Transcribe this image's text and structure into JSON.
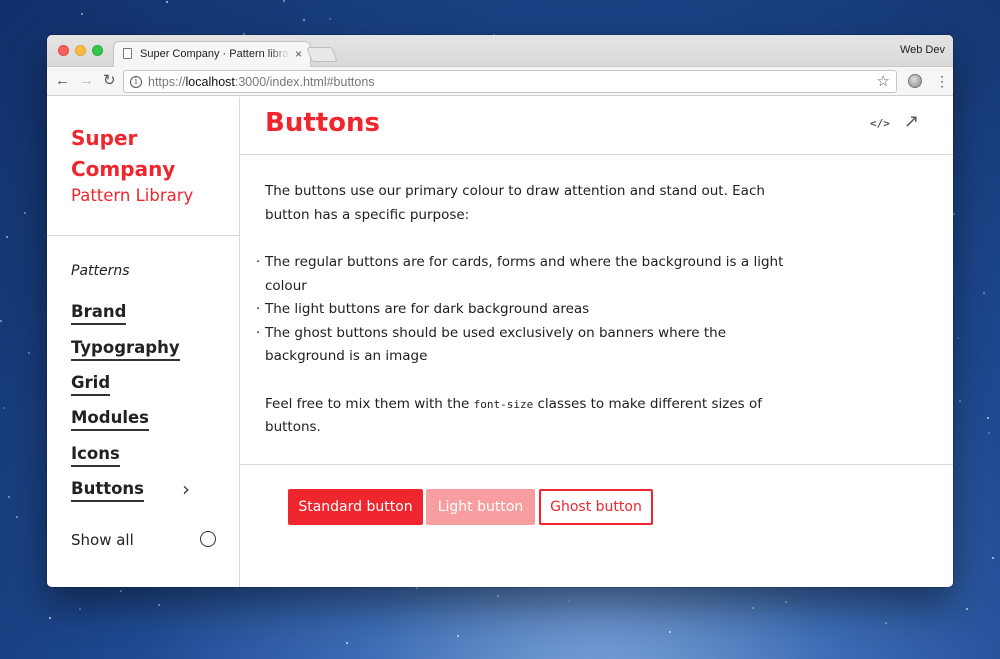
{
  "browser": {
    "tab_title": "Super Company · Pattern library",
    "tab_close": "×",
    "profile_name": "Web Dev",
    "url_scheme": "https://",
    "url_host": "localhost",
    "url_rest": ":3000/index.html#buttons",
    "back_glyph": "←",
    "forward_glyph": "→",
    "reload_glyph": "↻",
    "star_glyph": "☆",
    "menu_glyph": "⋮",
    "info_glyph": "i"
  },
  "sidebar": {
    "brand_line1": "Super",
    "brand_line2": "Company",
    "brand_sub": "Pattern Library",
    "section_label": "Patterns",
    "items": [
      {
        "label": "Brand"
      },
      {
        "label": "Typography"
      },
      {
        "label": "Grid"
      },
      {
        "label": "Modules"
      },
      {
        "label": "Icons"
      },
      {
        "label": "Buttons"
      }
    ],
    "chevron": "›",
    "show_all": "Show all"
  },
  "main": {
    "title": "Buttons",
    "code_icon": "</>",
    "open_icon": "↗",
    "intro": "The buttons use our primary colour to draw attention and stand out. Each button has a specific purpose:",
    "bullets": [
      "The regular buttons are for cards, forms and where the background is a light colour",
      "The light buttons are for dark background areas",
      "The ghost buttons should be used exclusively on banners where the background is an image"
    ],
    "outro_before": "Feel free to mix them with the ",
    "outro_code": "font-size",
    "outro_after": " classes to make different sizes of buttons.",
    "buttons": {
      "standard": "Standard button",
      "light": "Light button",
      "ghost": "Ghost button"
    }
  },
  "colors": {
    "primary": "#f0262e",
    "primary_light": "#f89ea1",
    "text": "#1e1e1e"
  }
}
